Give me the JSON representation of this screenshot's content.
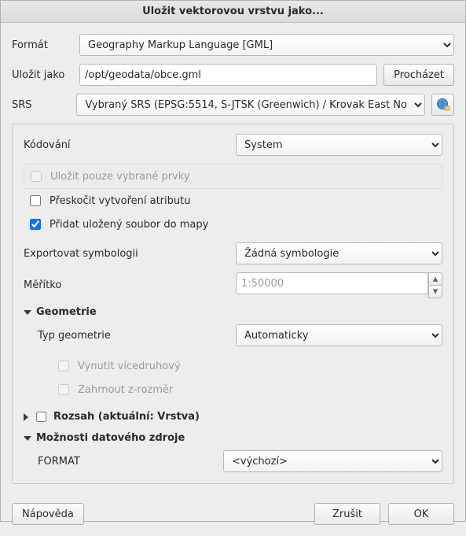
{
  "title": "Uložit vektorovou vrstvu jako...",
  "top": {
    "format_label": "Formát",
    "format_value": "Geography Markup Language [GML]",
    "save_as_label": "Uložit jako",
    "save_as_value": "/opt/geodata/obce.gml",
    "browse_label": "Procházet",
    "srs_label": "SRS",
    "srs_value": "Vybraný SRS (EPSG:5514, S-JTSK (Greenwich) / Krovak East No"
  },
  "panel": {
    "encoding_label": "Kódování",
    "encoding_value": "System",
    "save_selected_label": "Uložit pouze vybrané prvky",
    "skip_attr_label": "Přeskočit vytvoření atributu",
    "add_to_map_label": "Přidat uložený soubor do mapy",
    "export_symb_label": "Exportovat symbologii",
    "export_symb_value": "Žádná symbologie",
    "scale_label": "Měřítko",
    "scale_value": "1:50000",
    "geometry_head": "Geometrie",
    "geom_type_label": "Typ geometrie",
    "geom_type_value": "Automaticky",
    "force_multi_label": "Vynutit vícedruhový",
    "include_z_label": "Zahrnout z-rozměr",
    "extent_head": "Rozsah (aktuální: Vrstva)",
    "datasource_head": "Možnosti datového zdroje",
    "format_opt_label": "FORMAT",
    "format_opt_value": "<výchozí>"
  },
  "footer": {
    "help": "Nápověda",
    "cancel": "Zrušit",
    "ok": "OK"
  }
}
